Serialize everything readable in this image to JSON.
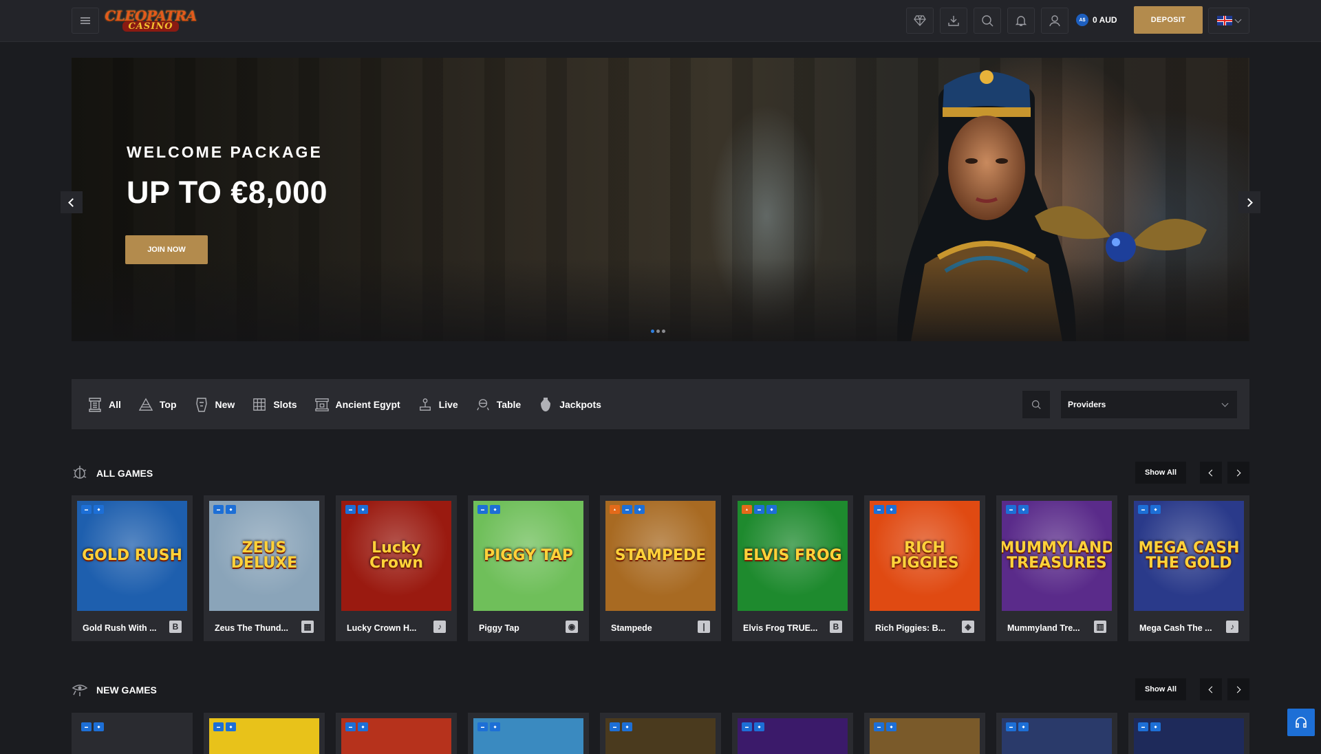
{
  "header": {
    "logo_line1": "CLEOPATRA",
    "logo_line2": "CASINO",
    "balance_currency": "A$",
    "balance": "0 AUD",
    "deposit_label": "DEPOSIT",
    "icons": [
      "diamond-icon",
      "download-icon",
      "search-icon",
      "bell-icon",
      "user-icon"
    ]
  },
  "hero": {
    "subtitle": "WELCOME PACKAGE",
    "title": "UP TO €8,000",
    "cta": "JOIN NOW",
    "slide_count": 3,
    "active_slide": 1
  },
  "categories": [
    {
      "label": "All",
      "icon": "all-games-icon"
    },
    {
      "label": "Top",
      "icon": "pyramid-icon"
    },
    {
      "label": "New",
      "icon": "pharaoh-icon"
    },
    {
      "label": "Slots",
      "icon": "slots-icon"
    },
    {
      "label": "Ancient Egypt",
      "icon": "temple-icon"
    },
    {
      "label": "Live",
      "icon": "live-dealer-icon"
    },
    {
      "label": "Table",
      "icon": "table-icon"
    },
    {
      "label": "Jackpots",
      "icon": "jackpot-vase-icon"
    }
  ],
  "filters": {
    "providers_label": "Providers"
  },
  "sections": {
    "all_games": {
      "title": "ALL GAMES",
      "show_all": "Show All",
      "games": [
        {
          "name": "Gold Rush With ...",
          "art": "GOLD RUSH",
          "bg": "#1e5fae",
          "prov": "B",
          "badges": [
            "new",
            "vip"
          ]
        },
        {
          "name": "Zeus The Thund...",
          "art": "ZEUS DELUXE",
          "bg": "#8aa4b9",
          "prov": "▦",
          "badges": [
            "new",
            "vip"
          ]
        },
        {
          "name": "Lucky Crown H...",
          "art": "Lucky Crown",
          "bg": "#9a1a10",
          "prov": "♪",
          "badges": [
            "new",
            "vip"
          ]
        },
        {
          "name": "Piggy Tap",
          "art": "PIGGY TAP",
          "bg": "#6fbf5a",
          "prov": "◉",
          "badges": [
            "new",
            "vip"
          ]
        },
        {
          "name": "Stampede",
          "art": "STAMPEDE",
          "bg": "#a86a22",
          "prov": "|",
          "badges": [
            "hot",
            "new",
            "vip"
          ]
        },
        {
          "name": "Elvis Frog TRUE...",
          "art": "ELVIS FROG",
          "bg": "#1e8a2e",
          "prov": "B",
          "badges": [
            "hot",
            "new",
            "vip"
          ]
        },
        {
          "name": "Rich Piggies: B...",
          "art": "RICH PIGGIES",
          "bg": "#e04a12",
          "prov": "◈",
          "badges": [
            "new",
            "vip"
          ]
        },
        {
          "name": "Mummyland Tre...",
          "art": "MUMMYLAND TREASURES",
          "bg": "#5a2b8a",
          "prov": "▥",
          "badges": [
            "new",
            "vip"
          ]
        },
        {
          "name": "Mega Cash The ...",
          "art": "MEGA CASH THE GOLD",
          "bg": "#2a3a8a",
          "prov": "♪",
          "badges": [
            "new",
            "vip"
          ]
        }
      ]
    },
    "new_games": {
      "title": "NEW GAMES",
      "show_all": "Show All",
      "tiles": [
        {
          "bg": "#2a2b30"
        },
        {
          "bg": "#e8c21a"
        },
        {
          "bg": "#b6321c"
        },
        {
          "bg": "#3a8ac0"
        },
        {
          "bg": "#4a3a1e"
        },
        {
          "bg": "#3b1a6a"
        },
        {
          "bg": "#7a5a2a"
        },
        {
          "bg": "#2a3a6a"
        },
        {
          "bg": "#1e2a5a"
        }
      ]
    }
  },
  "colors": {
    "accent_gold": "#b38b4d",
    "badge_blue": "#1d6fd6",
    "background": "#1b1c20"
  }
}
